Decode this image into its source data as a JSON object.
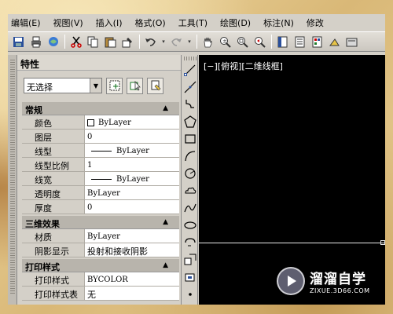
{
  "menubar": {
    "items": [
      {
        "label": "编辑(E)"
      },
      {
        "label": "视图(V)"
      },
      {
        "label": "插入(I)"
      },
      {
        "label": "格式(O)"
      },
      {
        "label": "工具(T)"
      },
      {
        "label": "绘图(D)"
      },
      {
        "label": "标注(N)"
      },
      {
        "label": "修改"
      }
    ]
  },
  "properties": {
    "title": "特性",
    "selection": "无选择",
    "sections": [
      {
        "title": "常规",
        "rows": [
          {
            "name": "颜色",
            "value": "ByLayer",
            "kind": "swatch"
          },
          {
            "name": "图层",
            "value": "0",
            "kind": "text"
          },
          {
            "name": "线型",
            "value": "ByLayer",
            "kind": "line"
          },
          {
            "name": "线型比例",
            "value": "1",
            "kind": "text"
          },
          {
            "name": "线宽",
            "value": "ByLayer",
            "kind": "line"
          },
          {
            "name": "透明度",
            "value": "ByLayer",
            "kind": "text"
          },
          {
            "name": "厚度",
            "value": "0",
            "kind": "text"
          }
        ]
      },
      {
        "title": "三维效果",
        "rows": [
          {
            "name": "材质",
            "value": "ByLayer",
            "kind": "text"
          },
          {
            "name": "阴影显示",
            "value": "投射和接收阴影",
            "kind": "text"
          }
        ]
      },
      {
        "title": "打印样式",
        "rows": [
          {
            "name": "打印样式",
            "value": "BYCOLOR",
            "kind": "text"
          },
          {
            "name": "打印样式表",
            "value": "无",
            "kind": "text"
          }
        ]
      }
    ]
  },
  "viewport": {
    "label": "[−][俯视][二维线框]"
  },
  "watermark": {
    "title": "溜溜自学",
    "subtitle": "ZIXUE.3D66.COM"
  },
  "colors": {
    "panel": "#d4d0c8",
    "viewport_bg": "#000000",
    "section_header": "#b8b4ac"
  }
}
